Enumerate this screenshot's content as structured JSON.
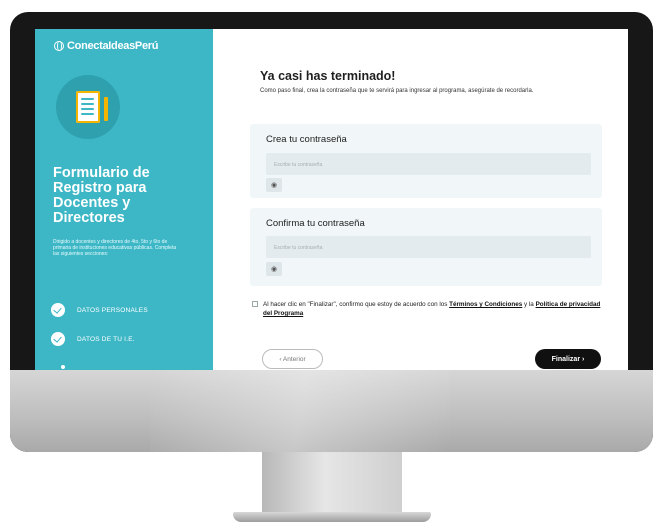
{
  "brand": {
    "logo_text": "ConectaIdeasPerú"
  },
  "sidebar": {
    "title": "Formulario de Registro para Docentes y Directores",
    "description": "Dirigido a docentes y directores de 4to, 5to y 6to de primaria de instituciones educativas públicas. Completa las siguientes secciones:",
    "steps": [
      {
        "label": "DATOS PERSONALES",
        "status": "completed"
      },
      {
        "label": "DATOS DE TU I.E.",
        "status": "completed"
      }
    ],
    "accent_color": "#3db7c6"
  },
  "main": {
    "heading": "Ya casi has terminado!",
    "intro": "Como paso final, crea la contraseña que te servirá para ingresar al programa, asegúrate de recordarla.",
    "password": {
      "label": "Crea tu contraseña",
      "placeholder": "Escribe tu contraseña",
      "toggle_icon": "eye-icon"
    },
    "confirm_password": {
      "label": "Confirma tu contraseña",
      "placeholder": "Escribe tu contraseña",
      "toggle_icon": "eye-icon"
    },
    "terms": {
      "prefix": "Al hacer clic en \"Finalizar\", confirmo que estoy de acuerdo con los ",
      "terms_link": "Términos y Condiciones",
      "middle": " y la ",
      "privacy_link": "Política de privacidad del Programa"
    },
    "buttons": {
      "prev": "‹ Anterior",
      "finish": "Finalizar ›"
    }
  }
}
